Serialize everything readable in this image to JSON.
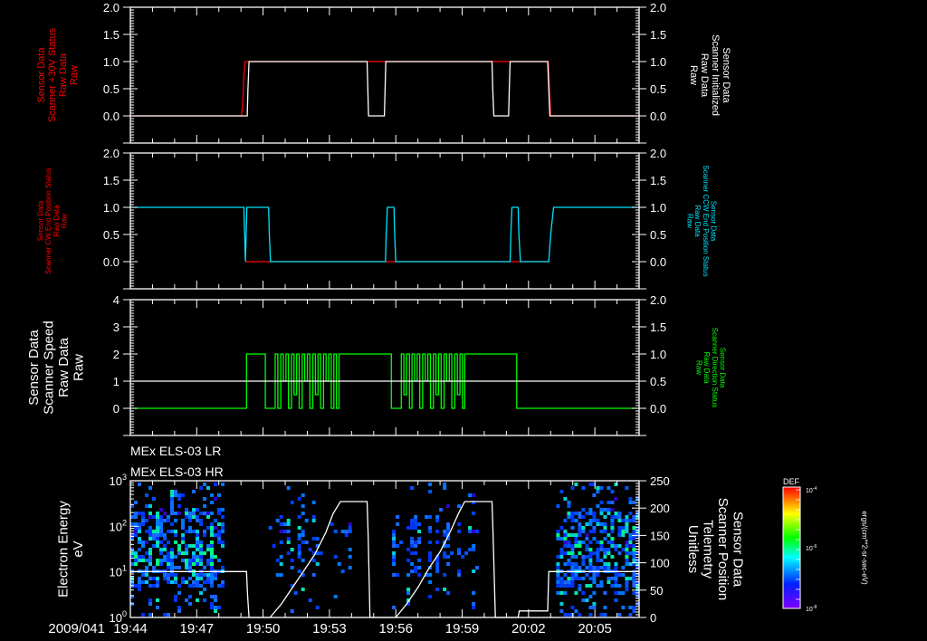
{
  "time_axis": {
    "date_prefix": "2009/041",
    "xlim": [
      "19:44:00",
      "20:07:00"
    ],
    "tick_labels": [
      "19:44",
      "19:47",
      "19:50",
      "19:53",
      "19:56",
      "19:59",
      "20:02",
      "20:05"
    ]
  },
  "colors": {
    "background": "#000000",
    "axes": "#ffffff",
    "red": "#ff0000",
    "cyan": "#00e5ff",
    "green": "#00ff00"
  },
  "chart_data": [
    {
      "type": "line",
      "left_axis": {
        "label": [
          "Sensor Data",
          "Scanner +30V Status",
          "Raw Data",
          "Raw"
        ],
        "color": "#ff0000",
        "ylim": [
          -0.5,
          2.0
        ],
        "ticks": [
          0,
          0.5,
          1.0,
          1.5,
          2.0
        ],
        "tick_labels": [
          "0.0",
          "0.5",
          "1.0",
          "1.5",
          "2.0"
        ]
      },
      "right_axis": {
        "label": [
          "Sensor Data",
          "Scanner Initialized",
          "Raw Data",
          "Raw"
        ],
        "color": "#ffffff",
        "ylim": [
          -0.5,
          2.0
        ],
        "ticks": [
          0,
          0.5,
          1.0,
          1.5,
          2.0
        ],
        "tick_labels": [
          "0.0",
          "0.5",
          "1.0",
          "1.5",
          "2.0"
        ]
      },
      "series": [
        {
          "name": "Scanner +30V Status",
          "axis": "left",
          "color": "#ff0000",
          "points": [
            [
              "19:44:00",
              0
            ],
            [
              "19:49:02",
              0
            ],
            [
              "19:49:05",
              0.25
            ],
            [
              "19:49:08",
              0.75
            ],
            [
              "19:49:11",
              1
            ],
            [
              "20:02:54",
              1
            ],
            [
              "20:02:57",
              0.5
            ],
            [
              "20:03:00",
              0
            ],
            [
              "20:07:00",
              0
            ]
          ]
        },
        {
          "name": "Scanner Initialized",
          "axis": "right",
          "color": "#ffffff",
          "points": [
            [
              "19:44:00",
              0
            ],
            [
              "19:49:17",
              0
            ],
            [
              "19:49:19",
              0.5
            ],
            [
              "19:49:22",
              1
            ],
            [
              "19:54:42",
              1
            ],
            [
              "19:54:44",
              0.5
            ],
            [
              "19:54:46",
              0
            ],
            [
              "19:55:29",
              0
            ],
            [
              "19:55:31",
              0.5
            ],
            [
              "19:55:33",
              1
            ],
            [
              "20:00:21",
              1
            ],
            [
              "20:00:23",
              0.5
            ],
            [
              "20:00:26",
              0
            ],
            [
              "20:01:06",
              0
            ],
            [
              "20:01:08",
              0.5
            ],
            [
              "20:01:10",
              1
            ],
            [
              "20:02:52",
              1
            ],
            [
              "20:02:55",
              0.5
            ],
            [
              "20:02:58",
              0
            ],
            [
              "20:07:00",
              0
            ]
          ]
        }
      ]
    },
    {
      "type": "line",
      "left_axis": {
        "label": [
          "Sensor Data",
          "Scanner CW End Position Status",
          "Raw Data",
          "Raw"
        ],
        "color": "#ff0000",
        "ylim": [
          -0.5,
          2.0
        ],
        "ticks": [
          0,
          0.5,
          1.0,
          1.5,
          2.0
        ],
        "tick_labels": [
          "0.0",
          "0.5",
          "1.0",
          "1.5",
          "2.0"
        ]
      },
      "right_axis": {
        "label": [
          "Sensor Data",
          "Scanner CCW End Position Status",
          "Raw Data",
          "Raw"
        ],
        "color": "#00e5ff",
        "ylim": [
          -0.5,
          2.0
        ],
        "ticks": [
          0,
          0.5,
          1.0,
          1.5,
          2.0
        ],
        "tick_labels": [
          "0.0",
          "0.5",
          "1.0",
          "1.5",
          "2.0"
        ]
      },
      "series": [
        {
          "name": "Scanner CW End Position Status",
          "axis": "left",
          "color": "#ff0000",
          "points": [
            [
              "19:49:12",
              0
            ],
            [
              "20:02:54",
              0
            ]
          ]
        },
        {
          "name": "Scanner CCW End Position Status",
          "axis": "right",
          "color": "#00e5ff",
          "points": [
            [
              "19:44:00",
              1
            ],
            [
              "19:49:08",
              1
            ],
            [
              "19:49:10",
              0.5
            ],
            [
              "19:49:12",
              0
            ],
            [
              "19:49:14",
              0.5
            ],
            [
              "19:49:16",
              1
            ],
            [
              "19:50:15",
              1
            ],
            [
              "19:50:17",
              0.5
            ],
            [
              "19:50:20",
              0
            ],
            [
              "19:55:32",
              0
            ],
            [
              "19:55:34",
              0.5
            ],
            [
              "19:55:37",
              1
            ],
            [
              "19:55:55",
              1
            ],
            [
              "19:55:57",
              0.5
            ],
            [
              "19:56:00",
              0
            ],
            [
              "20:01:10",
              0
            ],
            [
              "20:01:12",
              0.5
            ],
            [
              "20:01:15",
              1
            ],
            [
              "20:01:32",
              1
            ],
            [
              "20:01:34",
              0.5
            ],
            [
              "20:01:38",
              0
            ],
            [
              "20:02:55",
              0
            ],
            [
              "20:03:00",
              0.5
            ],
            [
              "20:03:08",
              1
            ],
            [
              "20:07:00",
              1
            ]
          ]
        }
      ]
    },
    {
      "type": "line",
      "left_axis": {
        "label": [
          "Sensor Data",
          "Scanner Speed",
          "Raw Data",
          "Raw"
        ],
        "color": "#ffffff",
        "ylim": [
          -1,
          4
        ],
        "ticks": [
          0,
          1,
          2,
          3,
          4
        ],
        "tick_labels": [
          "0",
          "1",
          "2",
          "3",
          "4"
        ]
      },
      "right_axis": {
        "label": [
          "Sensor Data",
          "Scanner Direction Status",
          "Raw Data",
          "Raw"
        ],
        "color": "#00ff00",
        "ylim": [
          -0.5,
          2.0
        ],
        "ticks": [
          0,
          0.5,
          1.0,
          1.5,
          2.0
        ],
        "tick_labels": [
          "0.0",
          "0.5",
          "1.0",
          "1.5",
          "2.0"
        ]
      },
      "series": [
        {
          "name": "Scanner Direction Status",
          "axis": "right",
          "color": "#00ff00",
          "step": true,
          "points": [
            [
              "19:44:00",
              0
            ],
            [
              "19:49:15",
              1
            ],
            [
              "19:50:06",
              0
            ],
            [
              "19:50:33",
              1
            ],
            [
              "19:50:40",
              0
            ],
            [
              "19:50:48",
              1
            ],
            [
              "19:50:55",
              0.5
            ],
            [
              "19:51:02",
              1
            ],
            [
              "19:51:09",
              0
            ],
            [
              "19:51:17",
              1
            ],
            [
              "19:51:24",
              0.25
            ],
            [
              "19:51:31",
              1
            ],
            [
              "19:51:38",
              0
            ],
            [
              "19:51:46",
              1
            ],
            [
              "19:51:53",
              0.5
            ],
            [
              "19:52:00",
              1
            ],
            [
              "19:52:07",
              0
            ],
            [
              "19:52:15",
              1
            ],
            [
              "19:52:22",
              0.25
            ],
            [
              "19:52:29",
              1
            ],
            [
              "19:52:36",
              0
            ],
            [
              "19:52:44",
              1
            ],
            [
              "19:52:51",
              0.5
            ],
            [
              "19:52:58",
              1
            ],
            [
              "19:53:05",
              0
            ],
            [
              "19:53:12",
              1
            ],
            [
              "19:53:19",
              0
            ],
            [
              "19:53:26",
              1
            ],
            [
              "19:55:48",
              0
            ],
            [
              "19:56:15",
              1
            ],
            [
              "19:56:22",
              0.25
            ],
            [
              "19:56:29",
              1
            ],
            [
              "19:56:37",
              0
            ],
            [
              "19:56:44",
              1
            ],
            [
              "19:56:51",
              0.5
            ],
            [
              "19:56:58",
              1
            ],
            [
              "19:57:05",
              0
            ],
            [
              "19:57:13",
              1
            ],
            [
              "19:57:20",
              0.5
            ],
            [
              "19:57:27",
              1
            ],
            [
              "19:57:34",
              0
            ],
            [
              "19:57:42",
              1
            ],
            [
              "19:57:49",
              0.25
            ],
            [
              "19:57:56",
              1
            ],
            [
              "19:58:03",
              0
            ],
            [
              "19:58:11",
              1
            ],
            [
              "19:58:18",
              0.5
            ],
            [
              "19:58:25",
              1
            ],
            [
              "19:58:32",
              0
            ],
            [
              "19:58:40",
              1
            ],
            [
              "19:58:47",
              0.25
            ],
            [
              "19:58:54",
              1
            ],
            [
              "19:59:01",
              0
            ],
            [
              "19:59:07",
              1
            ],
            [
              "20:01:28",
              0
            ],
            [
              "20:07:00",
              0
            ]
          ]
        },
        {
          "name": "Scanner Speed",
          "axis": "left",
          "color": "#ffffff",
          "points": [
            [
              "19:44:00",
              1
            ],
            [
              "20:07:00",
              1
            ]
          ]
        }
      ]
    },
    {
      "type": "heatmap",
      "titles": [
        "MEx ELS-03 LR",
        "MEx ELS-03 HR"
      ],
      "left_axis": {
        "label": [
          "Electron Energy",
          "eV"
        ],
        "color": "#ffffff",
        "scale": "log",
        "ylim": [
          1,
          1000
        ],
        "ticks": [
          1,
          10,
          100,
          1000
        ],
        "tick_labels": [
          {
            "base": "10",
            "exp": "0"
          },
          {
            "base": "10",
            "exp": "1"
          },
          {
            "base": "10",
            "exp": "2"
          },
          {
            "base": "10",
            "exp": "3"
          }
        ]
      },
      "right_axis": {
        "label": [
          "Sensor Data",
          "Scanner Position",
          "Telemetry",
          "Unitless"
        ],
        "color": "#ffffff",
        "ylim": [
          0,
          250
        ],
        "ticks": [
          0,
          50,
          100,
          150,
          200,
          250
        ],
        "tick_labels": [
          "0",
          "50",
          "100",
          "150",
          "200",
          "250"
        ]
      },
      "spectrogram_coverage": [
        {
          "start": "19:44:00",
          "end": "19:48:20",
          "density": "dense"
        },
        {
          "start": "19:50:15",
          "end": "19:54:00",
          "density": "sparse"
        },
        {
          "start": "19:55:50",
          "end": "19:59:48",
          "density": "sparse"
        },
        {
          "start": "20:03:15",
          "end": "20:07:00",
          "density": "dense"
        }
      ],
      "colorbar": {
        "title": "DEF",
        "scale": "log",
        "range": [
          1e-08,
          0.0001
        ],
        "tick_labels": [
          {
            "base": "10",
            "exp": "-4"
          },
          {
            "base": "10",
            "exp": "-6"
          },
          {
            "base": "10",
            "exp": "-8"
          }
        ],
        "unit": "ergs/(cm**2-sr-sec-eV)"
      },
      "series": [
        {
          "name": "Scanner Position",
          "axis": "right",
          "color": "#ffffff",
          "points": [
            [
              "19:44:00",
              84
            ],
            [
              "19:49:15",
              84
            ],
            [
              "19:49:18",
              40
            ],
            [
              "19:49:22",
              0
            ],
            [
              "19:50:19",
              0
            ],
            [
              "19:50:50",
              25
            ],
            [
              "19:51:20",
              55
            ],
            [
              "19:51:50",
              85
            ],
            [
              "19:52:20",
              115
            ],
            [
              "19:52:50",
              155
            ],
            [
              "19:53:10",
              190
            ],
            [
              "19:53:30",
              212
            ],
            [
              "19:54:42",
              212
            ],
            [
              "19:54:45",
              150
            ],
            [
              "19:54:50",
              0
            ],
            [
              "19:56:00",
              0
            ],
            [
              "19:56:30",
              25
            ],
            [
              "19:57:00",
              55
            ],
            [
              "19:57:30",
              90
            ],
            [
              "19:58:00",
              120
            ],
            [
              "19:58:30",
              160
            ],
            [
              "19:58:50",
              190
            ],
            [
              "19:59:07",
              212
            ],
            [
              "20:00:21",
              212
            ],
            [
              "20:00:24",
              150
            ],
            [
              "20:00:30",
              0
            ],
            [
              "20:01:32",
              0
            ],
            [
              "20:01:35",
              12
            ],
            [
              "20:02:52",
              12
            ],
            [
              "20:02:55",
              84
            ],
            [
              "20:07:00",
              84
            ]
          ]
        }
      ]
    }
  ]
}
